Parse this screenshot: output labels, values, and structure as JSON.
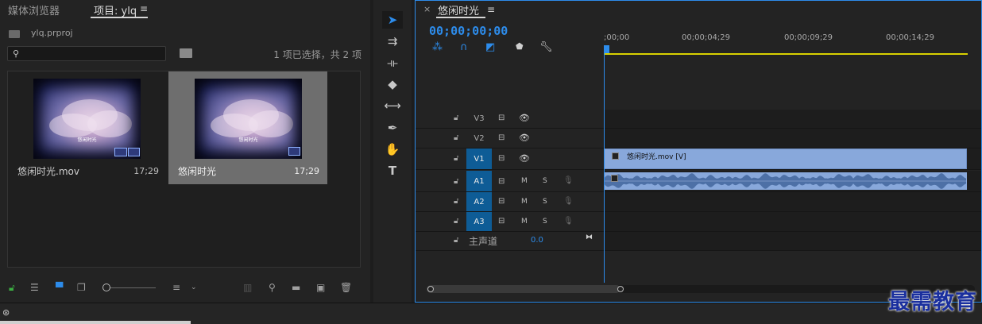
{
  "project_panel": {
    "tabs": [
      {
        "label": "媒体浏览器",
        "active": false
      },
      {
        "label": "项目: ylq",
        "active": true
      }
    ],
    "menu_glyph": "≡",
    "project_file": "ylq.prproj",
    "search_placeholder": "",
    "selection_count": "1 项已选择，共 2 项",
    "clips": [
      {
        "name": "悠闲时光.mov",
        "duration": "17;29",
        "thumb_text": "悠闲时光",
        "selected": false
      },
      {
        "name": "悠闲时光",
        "duration": "17;29",
        "thumb_text": "悠闲时光",
        "selected": true
      }
    ]
  },
  "tools": [
    {
      "name": "selection-tool",
      "glyph": "➤"
    },
    {
      "name": "track-select-tool",
      "glyph": "⇉"
    },
    {
      "name": "ripple-edit-tool",
      "glyph": "⟛"
    },
    {
      "name": "razor-tool",
      "glyph": "◆"
    },
    {
      "name": "slip-tool",
      "glyph": "⟷"
    },
    {
      "name": "pen-tool",
      "glyph": "✒"
    },
    {
      "name": "hand-tool",
      "glyph": "✋"
    },
    {
      "name": "type-tool",
      "glyph": "T"
    }
  ],
  "timeline": {
    "close_glyph": "×",
    "sequence_name": "悠闲时光",
    "menu_glyph": "≡",
    "timecode": "00;00;00;00",
    "ruler_labels": [
      ";00;00",
      "00;00;04;29",
      "00;00;09;29",
      "00;00;14;29"
    ],
    "video_tracks": [
      {
        "label": "V3",
        "targeted": false
      },
      {
        "label": "V2",
        "targeted": false
      },
      {
        "label": "V1",
        "targeted": true
      }
    ],
    "audio_tracks": [
      {
        "label": "A1",
        "targeted": true,
        "mute": "M",
        "solo": "S"
      },
      {
        "label": "A2",
        "targeted": true,
        "mute": "M",
        "solo": "S"
      },
      {
        "label": "A3",
        "targeted": true,
        "mute": "M",
        "solo": "S"
      }
    ],
    "video_clip_label": "悠闲时光.mov [V]",
    "master_track_label": "主声道",
    "master_value": "0.0"
  },
  "watermark": "最需教育",
  "colors": {
    "accent": "#2d8ceb",
    "clip": "#88a8db",
    "work_area": "#d8d000",
    "track_target": "#0e5c96"
  }
}
